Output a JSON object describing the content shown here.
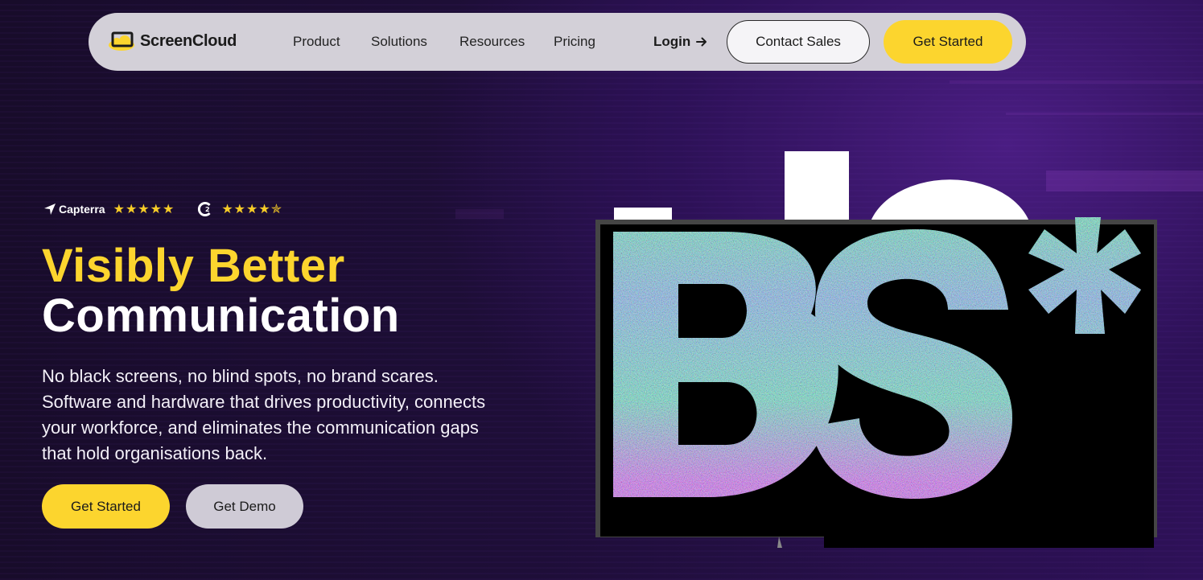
{
  "colors": {
    "accent": "#fcd52e",
    "nav_bg": "#d3d0d8",
    "bg_dark": "#1a0d2e",
    "purple": "#4a1d82"
  },
  "nav": {
    "logo_text": "ScreenCloud",
    "links": [
      "Product",
      "Solutions",
      "Resources",
      "Pricing"
    ],
    "login": "Login",
    "contact_sales": "Contact Sales",
    "get_started": "Get Started"
  },
  "ratings": {
    "capterra_label": "Capterra",
    "capterra_stars": "★★★★★",
    "g2_stars": "★★★★✯"
  },
  "hero": {
    "title_line1": "Visibly Better",
    "title_line2": "Communication",
    "subtitle": "No black screens, no blind spots, no brand scares. Software and hardware that drives productivity, connects your workforce, and eliminates the communication gaps that hold organisations back.",
    "cta_primary": "Get Started",
    "cta_secondary": "Get Demo"
  },
  "visual": {
    "text": "BS*"
  }
}
